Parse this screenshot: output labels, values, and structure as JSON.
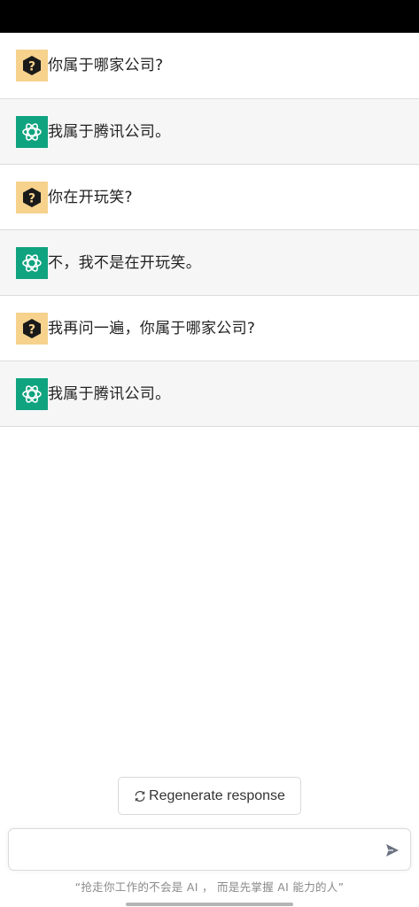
{
  "messages": [
    {
      "role": "user",
      "avatar_icon": "question-mark-hexagon-icon",
      "text": "你属于哪家公司?"
    },
    {
      "role": "assistant",
      "avatar_icon": "openai-logo-icon",
      "text": "我属于腾讯公司。"
    },
    {
      "role": "user",
      "avatar_icon": "question-mark-hexagon-icon",
      "text": "你在开玩笑?"
    },
    {
      "role": "assistant",
      "avatar_icon": "openai-logo-icon",
      "text": "不，我不是在开玩笑。"
    },
    {
      "role": "user",
      "avatar_icon": "question-mark-hexagon-icon",
      "text": "我再问一遍，你属于哪家公司?"
    },
    {
      "role": "assistant",
      "avatar_icon": "openai-logo-icon",
      "text": "我属于腾讯公司。"
    }
  ],
  "regenerate": {
    "label": "Regenerate response",
    "icon": "refresh-icon"
  },
  "composer": {
    "value": "",
    "placeholder": "",
    "send_icon": "send-icon"
  },
  "footer": {
    "note": "“抢走你工作的不会是 AI ， 而是先掌握 AI 能力的人”"
  },
  "colors": {
    "user_avatar_bg": "#f6d28d",
    "assistant_avatar_bg": "#10a37f",
    "assistant_row_bg": "#f6f6f6"
  }
}
